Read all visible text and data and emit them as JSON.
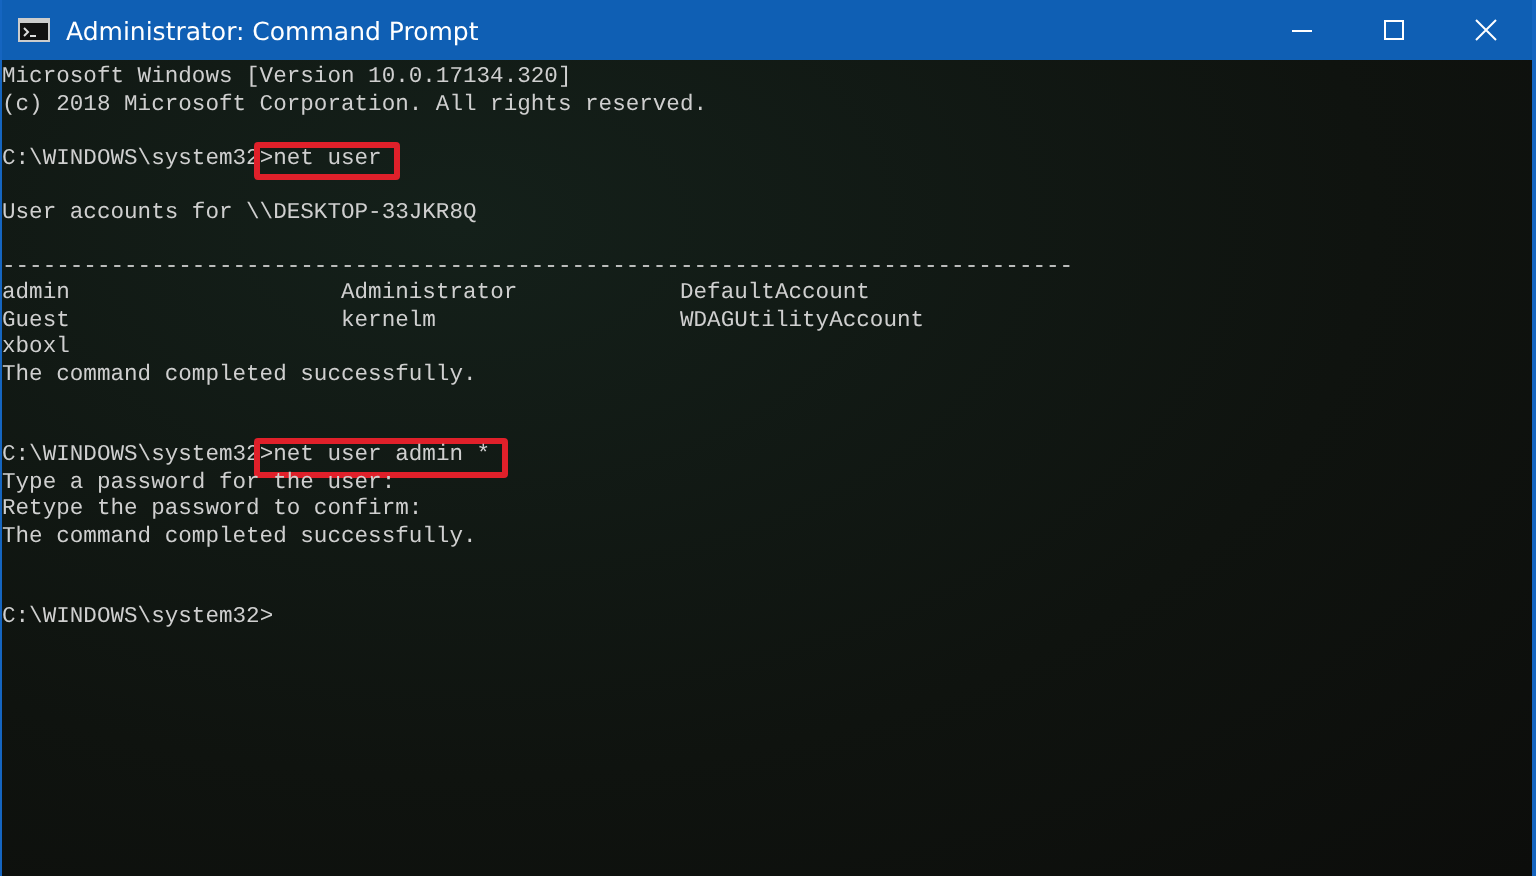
{
  "window": {
    "title": "Administrator: Command Prompt"
  },
  "console": {
    "lines": [
      {
        "kind": "text",
        "text": "Microsoft Windows [Version 10.0.17134.320]"
      },
      {
        "kind": "text",
        "text": "(c) 2018 Microsoft Corporation. All rights reserved."
      },
      {
        "kind": "blank"
      },
      {
        "kind": "prompt",
        "path": "C:\\WINDOWS\\system32",
        "symbol": ">",
        "command": "net user",
        "highlighted": true
      },
      {
        "kind": "blank"
      },
      {
        "kind": "text",
        "text": "User accounts for \\\\DESKTOP-33JKR8Q"
      },
      {
        "kind": "blank"
      },
      {
        "kind": "text",
        "text": "-------------------------------------------------------------------------------"
      },
      {
        "kind": "accounts",
        "cells": [
          "admin",
          "Administrator",
          "DefaultAccount"
        ]
      },
      {
        "kind": "accounts",
        "cells": [
          "Guest",
          "kernelm",
          "WDAGUtilityAccount"
        ]
      },
      {
        "kind": "accounts",
        "cells": [
          "xboxl"
        ]
      },
      {
        "kind": "text",
        "text": "The command completed successfully."
      },
      {
        "kind": "blank"
      },
      {
        "kind": "blank"
      },
      {
        "kind": "prompt",
        "path": "C:\\WINDOWS\\system32",
        "symbol": ">",
        "command": "net user admin *",
        "highlighted": true
      },
      {
        "kind": "text",
        "text": "Type a password for the user:"
      },
      {
        "kind": "text",
        "text": "Retype the password to confirm:"
      },
      {
        "kind": "text",
        "text": "The command completed successfully."
      },
      {
        "kind": "blank"
      },
      {
        "kind": "blank"
      },
      {
        "kind": "prompt",
        "path": "C:\\WINDOWS\\system32",
        "symbol": ">",
        "highlighted": false
      }
    ]
  }
}
